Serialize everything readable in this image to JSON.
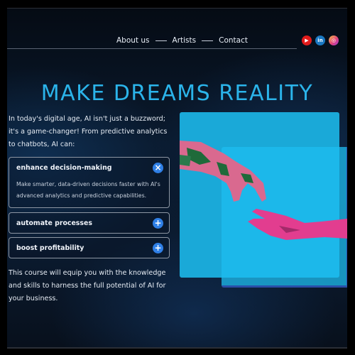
{
  "nav": {
    "links": [
      {
        "label": "About us"
      },
      {
        "label": "Artists"
      },
      {
        "label": "Contact"
      }
    ],
    "social": [
      {
        "icon": "youtube-icon",
        "glyph": "▶"
      },
      {
        "icon": "linkedin-icon",
        "glyph": "in"
      },
      {
        "icon": "instagram-icon",
        "glyph": "◎"
      }
    ]
  },
  "hero": {
    "title": "MAKE DREAMS REALITY",
    "intro": "In today's digital age, AI isn't just a buzzword; it's a game-changer! From predictive analytics to chatbots, AI can:",
    "accordion": [
      {
        "title": "enhance decision-making",
        "expanded": true,
        "icon": "×",
        "body": "Make smarter, data-driven decisions faster with AI's advanced analytics and predictive capabilities."
      },
      {
        "title": "automate processes",
        "expanded": false,
        "icon": "+"
      },
      {
        "title": "boost profitability",
        "expanded": false,
        "icon": "+"
      }
    ],
    "outro": "This course will equip you with the knowledge and skills to harness the full potential of AI for your business."
  },
  "colors": {
    "accent": "#2bb4ea",
    "button": "#2f7fe6",
    "image_bg": "#1aa9d8"
  }
}
